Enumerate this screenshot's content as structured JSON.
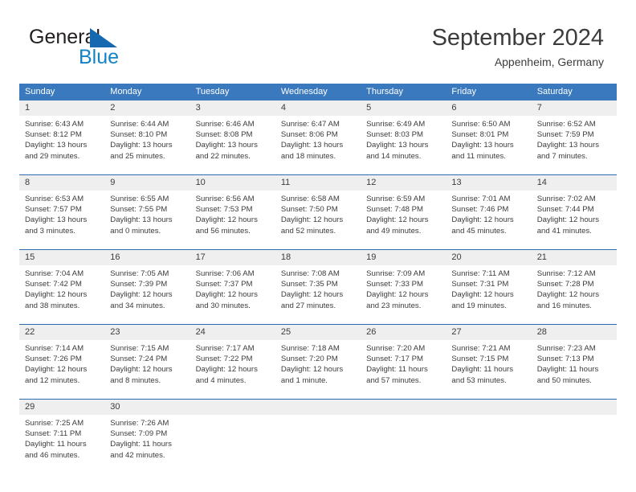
{
  "logo": {
    "text_primary": "General",
    "text_secondary": "Blue",
    "triangle_icon": "triangle-icon",
    "color_primary": "#231f20",
    "color_secondary": "#1383c6",
    "color_triangle": "#1669b0"
  },
  "header": {
    "month_title": "September 2024",
    "location": "Appenheim, Germany"
  },
  "theme": {
    "header_blue": "#3a79bd",
    "row_border_blue": "#2c6bb0",
    "day_strip_gray": "#efefef",
    "text_color": "#3c3c3c"
  },
  "calendar": {
    "weekdays": [
      "Sunday",
      "Monday",
      "Tuesday",
      "Wednesday",
      "Thursday",
      "Friday",
      "Saturday"
    ],
    "weeks": [
      [
        {
          "day": "1",
          "sunrise": "Sunrise: 6:43 AM",
          "sunset": "Sunset: 8:12 PM",
          "daylight_1": "Daylight: 13 hours",
          "daylight_2": "and 29 minutes."
        },
        {
          "day": "2",
          "sunrise": "Sunrise: 6:44 AM",
          "sunset": "Sunset: 8:10 PM",
          "daylight_1": "Daylight: 13 hours",
          "daylight_2": "and 25 minutes."
        },
        {
          "day": "3",
          "sunrise": "Sunrise: 6:46 AM",
          "sunset": "Sunset: 8:08 PM",
          "daylight_1": "Daylight: 13 hours",
          "daylight_2": "and 22 minutes."
        },
        {
          "day": "4",
          "sunrise": "Sunrise: 6:47 AM",
          "sunset": "Sunset: 8:06 PM",
          "daylight_1": "Daylight: 13 hours",
          "daylight_2": "and 18 minutes."
        },
        {
          "day": "5",
          "sunrise": "Sunrise: 6:49 AM",
          "sunset": "Sunset: 8:03 PM",
          "daylight_1": "Daylight: 13 hours",
          "daylight_2": "and 14 minutes."
        },
        {
          "day": "6",
          "sunrise": "Sunrise: 6:50 AM",
          "sunset": "Sunset: 8:01 PM",
          "daylight_1": "Daylight: 13 hours",
          "daylight_2": "and 11 minutes."
        },
        {
          "day": "7",
          "sunrise": "Sunrise: 6:52 AM",
          "sunset": "Sunset: 7:59 PM",
          "daylight_1": "Daylight: 13 hours",
          "daylight_2": "and 7 minutes."
        }
      ],
      [
        {
          "day": "8",
          "sunrise": "Sunrise: 6:53 AM",
          "sunset": "Sunset: 7:57 PM",
          "daylight_1": "Daylight: 13 hours",
          "daylight_2": "and 3 minutes."
        },
        {
          "day": "9",
          "sunrise": "Sunrise: 6:55 AM",
          "sunset": "Sunset: 7:55 PM",
          "daylight_1": "Daylight: 13 hours",
          "daylight_2": "and 0 minutes."
        },
        {
          "day": "10",
          "sunrise": "Sunrise: 6:56 AM",
          "sunset": "Sunset: 7:53 PM",
          "daylight_1": "Daylight: 12 hours",
          "daylight_2": "and 56 minutes."
        },
        {
          "day": "11",
          "sunrise": "Sunrise: 6:58 AM",
          "sunset": "Sunset: 7:50 PM",
          "daylight_1": "Daylight: 12 hours",
          "daylight_2": "and 52 minutes."
        },
        {
          "day": "12",
          "sunrise": "Sunrise: 6:59 AM",
          "sunset": "Sunset: 7:48 PM",
          "daylight_1": "Daylight: 12 hours",
          "daylight_2": "and 49 minutes."
        },
        {
          "day": "13",
          "sunrise": "Sunrise: 7:01 AM",
          "sunset": "Sunset: 7:46 PM",
          "daylight_1": "Daylight: 12 hours",
          "daylight_2": "and 45 minutes."
        },
        {
          "day": "14",
          "sunrise": "Sunrise: 7:02 AM",
          "sunset": "Sunset: 7:44 PM",
          "daylight_1": "Daylight: 12 hours",
          "daylight_2": "and 41 minutes."
        }
      ],
      [
        {
          "day": "15",
          "sunrise": "Sunrise: 7:04 AM",
          "sunset": "Sunset: 7:42 PM",
          "daylight_1": "Daylight: 12 hours",
          "daylight_2": "and 38 minutes."
        },
        {
          "day": "16",
          "sunrise": "Sunrise: 7:05 AM",
          "sunset": "Sunset: 7:39 PM",
          "daylight_1": "Daylight: 12 hours",
          "daylight_2": "and 34 minutes."
        },
        {
          "day": "17",
          "sunrise": "Sunrise: 7:06 AM",
          "sunset": "Sunset: 7:37 PM",
          "daylight_1": "Daylight: 12 hours",
          "daylight_2": "and 30 minutes."
        },
        {
          "day": "18",
          "sunrise": "Sunrise: 7:08 AM",
          "sunset": "Sunset: 7:35 PM",
          "daylight_1": "Daylight: 12 hours",
          "daylight_2": "and 27 minutes."
        },
        {
          "day": "19",
          "sunrise": "Sunrise: 7:09 AM",
          "sunset": "Sunset: 7:33 PM",
          "daylight_1": "Daylight: 12 hours",
          "daylight_2": "and 23 minutes."
        },
        {
          "day": "20",
          "sunrise": "Sunrise: 7:11 AM",
          "sunset": "Sunset: 7:31 PM",
          "daylight_1": "Daylight: 12 hours",
          "daylight_2": "and 19 minutes."
        },
        {
          "day": "21",
          "sunrise": "Sunrise: 7:12 AM",
          "sunset": "Sunset: 7:28 PM",
          "daylight_1": "Daylight: 12 hours",
          "daylight_2": "and 16 minutes."
        }
      ],
      [
        {
          "day": "22",
          "sunrise": "Sunrise: 7:14 AM",
          "sunset": "Sunset: 7:26 PM",
          "daylight_1": "Daylight: 12 hours",
          "daylight_2": "and 12 minutes."
        },
        {
          "day": "23",
          "sunrise": "Sunrise: 7:15 AM",
          "sunset": "Sunset: 7:24 PM",
          "daylight_1": "Daylight: 12 hours",
          "daylight_2": "and 8 minutes."
        },
        {
          "day": "24",
          "sunrise": "Sunrise: 7:17 AM",
          "sunset": "Sunset: 7:22 PM",
          "daylight_1": "Daylight: 12 hours",
          "daylight_2": "and 4 minutes."
        },
        {
          "day": "25",
          "sunrise": "Sunrise: 7:18 AM",
          "sunset": "Sunset: 7:20 PM",
          "daylight_1": "Daylight: 12 hours",
          "daylight_2": "and 1 minute."
        },
        {
          "day": "26",
          "sunrise": "Sunrise: 7:20 AM",
          "sunset": "Sunset: 7:17 PM",
          "daylight_1": "Daylight: 11 hours",
          "daylight_2": "and 57 minutes."
        },
        {
          "day": "27",
          "sunrise": "Sunrise: 7:21 AM",
          "sunset": "Sunset: 7:15 PM",
          "daylight_1": "Daylight: 11 hours",
          "daylight_2": "and 53 minutes."
        },
        {
          "day": "28",
          "sunrise": "Sunrise: 7:23 AM",
          "sunset": "Sunset: 7:13 PM",
          "daylight_1": "Daylight: 11 hours",
          "daylight_2": "and 50 minutes."
        }
      ],
      [
        {
          "day": "29",
          "sunrise": "Sunrise: 7:25 AM",
          "sunset": "Sunset: 7:11 PM",
          "daylight_1": "Daylight: 11 hours",
          "daylight_2": "and 46 minutes."
        },
        {
          "day": "30",
          "sunrise": "Sunrise: 7:26 AM",
          "sunset": "Sunset: 7:09 PM",
          "daylight_1": "Daylight: 11 hours",
          "daylight_2": "and 42 minutes."
        },
        {
          "day": "",
          "sunrise": "",
          "sunset": "",
          "daylight_1": "",
          "daylight_2": ""
        },
        {
          "day": "",
          "sunrise": "",
          "sunset": "",
          "daylight_1": "",
          "daylight_2": ""
        },
        {
          "day": "",
          "sunrise": "",
          "sunset": "",
          "daylight_1": "",
          "daylight_2": ""
        },
        {
          "day": "",
          "sunrise": "",
          "sunset": "",
          "daylight_1": "",
          "daylight_2": ""
        },
        {
          "day": "",
          "sunrise": "",
          "sunset": "",
          "daylight_1": "",
          "daylight_2": ""
        }
      ]
    ]
  }
}
